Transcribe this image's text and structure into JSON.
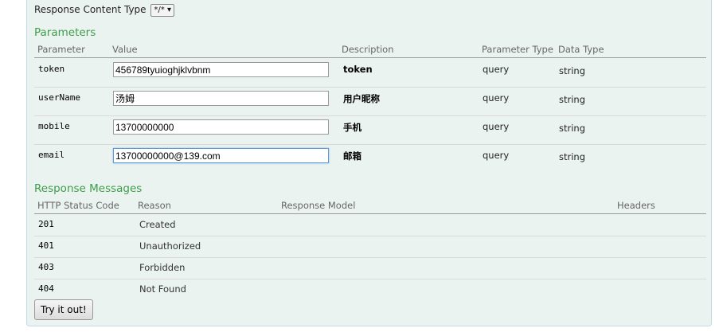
{
  "response_content_type": {
    "label": "Response Content Type",
    "selected": "*/* ▾"
  },
  "parameters": {
    "title": "Parameters",
    "headers": {
      "parameter": "Parameter",
      "value": "Value",
      "description": "Description",
      "parameter_type": "Parameter Type",
      "data_type": "Data Type"
    },
    "rows": [
      {
        "name": "token",
        "value": "456789tyuioghjklvbnm",
        "description": "token",
        "parameter_type": "query",
        "data_type": "string"
      },
      {
        "name": "userName",
        "value": "汤姆",
        "description": "用户昵称",
        "parameter_type": "query",
        "data_type": "string"
      },
      {
        "name": "mobile",
        "value": "13700000000",
        "description": "手机",
        "parameter_type": "query",
        "data_type": "string"
      },
      {
        "name": "email",
        "value": "13700000000@139.com",
        "description": "邮箱",
        "parameter_type": "query",
        "data_type": "string"
      }
    ]
  },
  "response_messages": {
    "title": "Response Messages",
    "headers": {
      "status_code": "HTTP Status Code",
      "reason": "Reason",
      "response_model": "Response Model",
      "headers": "Headers"
    },
    "rows": [
      {
        "code": "201",
        "reason": "Created"
      },
      {
        "code": "401",
        "reason": "Unauthorized"
      },
      {
        "code": "403",
        "reason": "Forbidden"
      },
      {
        "code": "404",
        "reason": "Not Found"
      }
    ]
  },
  "try_button": {
    "label": "Try it out!"
  }
}
